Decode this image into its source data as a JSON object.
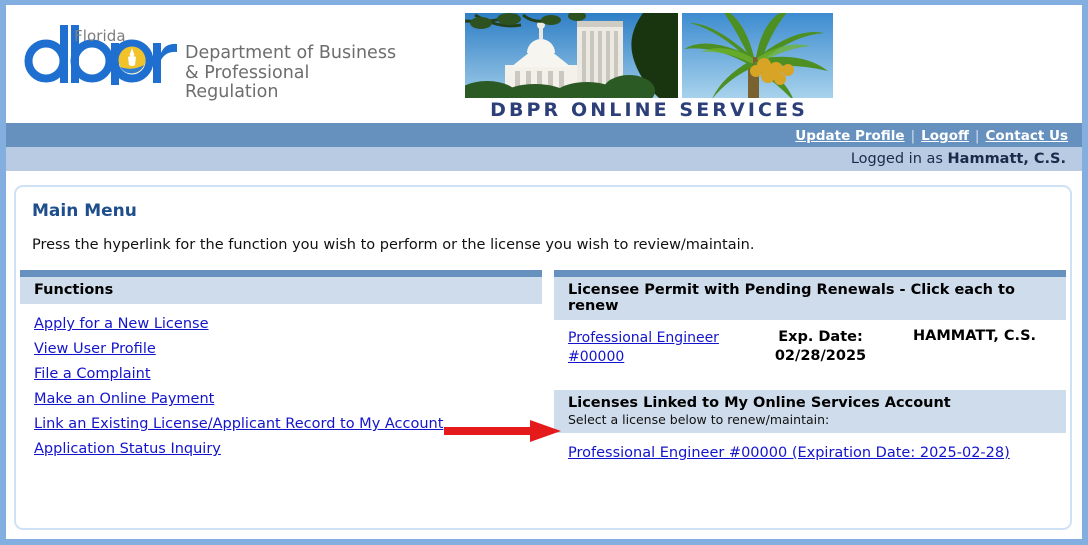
{
  "brand": {
    "logo_word": "dbpr",
    "logo_state": "Florida",
    "logo_department": "Department of Business\n& Professional Regulation",
    "banner_caption": "DBPR ONLINE SERVICES",
    "colors": {
      "logo_blue": "#1f6fd0",
      "logo_yellow": "#f2c22a",
      "nav_blue": "#6690bd",
      "subnav_blue": "#b8cbe3",
      "panel_head_blue": "#cfdceb",
      "link_blue": "#1414cc",
      "title_blue": "#1f4e8c",
      "arrow_red": "#e51b1b",
      "frame_blue": "#82aee0"
    }
  },
  "topnav": {
    "items": [
      {
        "label": "Update Profile"
      },
      {
        "label": "Logoff"
      },
      {
        "label": "Contact Us"
      }
    ],
    "separator": "|"
  },
  "session": {
    "logged_in_prefix": "Logged in as",
    "user_name": "Hammatt, C.S."
  },
  "main": {
    "title": "Main Menu",
    "instructions": "Press the hyperlink for the function you wish to perform or the license you wish to review/maintain."
  },
  "functions_panel": {
    "header": "Functions",
    "links": [
      {
        "label": "Apply for a New License"
      },
      {
        "label": "View User Profile"
      },
      {
        "label": "File a Complaint"
      },
      {
        "label": "Make an Online Payment"
      },
      {
        "label": "Link an Existing License/Applicant Record to My Account"
      },
      {
        "label": "Application Status Inquiry"
      }
    ]
  },
  "pending_renewals_panel": {
    "header": "Licensee Permit with Pending Renewals - Click each to renew",
    "rows": [
      {
        "license_link": "Professional Engineer #00000",
        "exp_label": "Exp. Date:",
        "exp_date": "02/28/2025",
        "holder": "HAMMATT, C.S."
      }
    ]
  },
  "linked_licenses_panel": {
    "header": "Licenses Linked to My Online Services Account",
    "subheader": "Select a license below to renew/maintain:",
    "rows": [
      {
        "label": "Professional Engineer #00000 (Expiration Date: 2025-02-28)"
      }
    ]
  },
  "annotation": {
    "arrow": "red-right-arrow",
    "points_to": "Professional Engineer #00000 (Expiration Date: 2025-02-28)"
  }
}
